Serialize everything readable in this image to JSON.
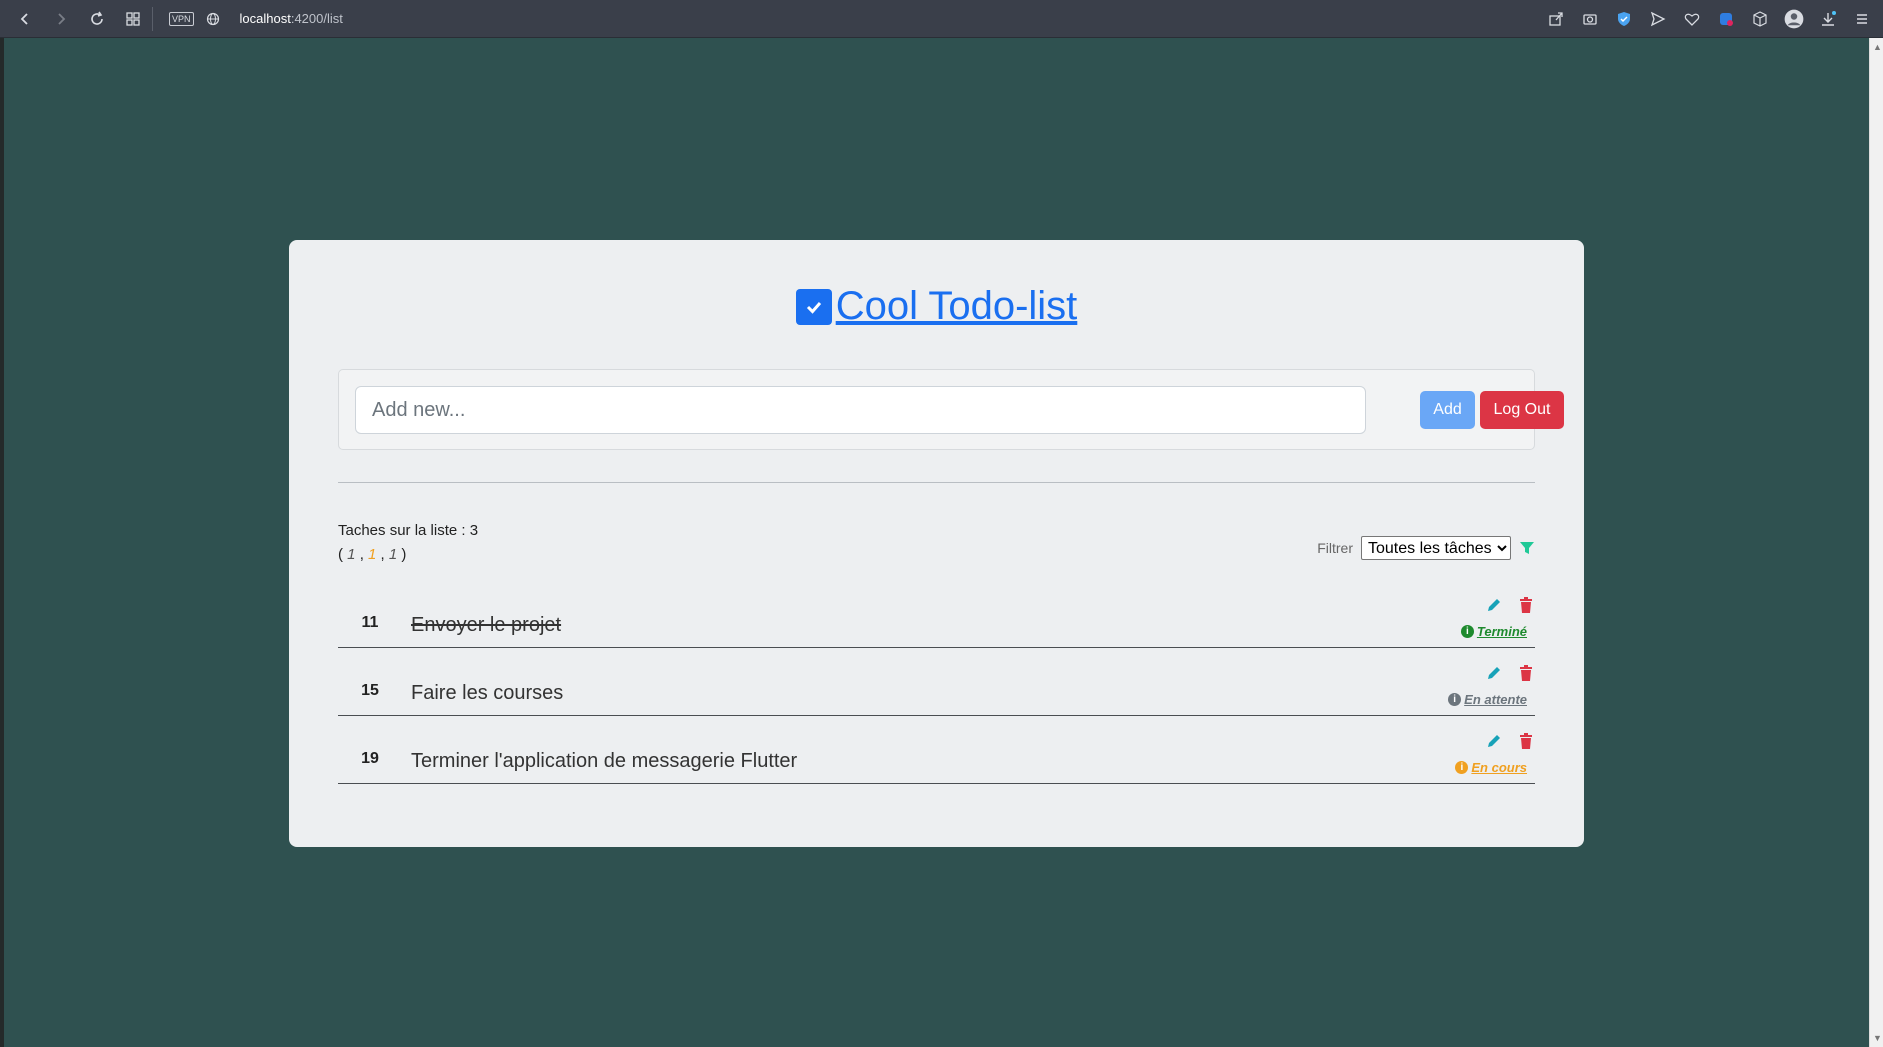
{
  "browser": {
    "url_host": "localhost",
    "url_path": ":4200/list",
    "vpn_label": "VPN"
  },
  "app": {
    "title": "Cool Todo-list",
    "add_placeholder": "Add new...",
    "add_label": "Add",
    "logout_label": "Log Out"
  },
  "summary": {
    "label": "Taches sur la liste : 3",
    "open": "(",
    "close": ")",
    "sep": ",",
    "counts": [
      "1",
      "1",
      "1"
    ]
  },
  "filter": {
    "label": "Filtrer",
    "selected": "Toutes les tâches",
    "icon": "filter-icon",
    "color": "#20c997"
  },
  "tasks": [
    {
      "id": "11",
      "text": "Envoyer le projet",
      "status": "Terminé",
      "status_color": "#1e8a2e",
      "done": true
    },
    {
      "id": "15",
      "text": "Faire les courses",
      "status": "En attente",
      "status_color": "#6c757d",
      "done": false
    },
    {
      "id": "19",
      "text": "Terminer l'application de messagerie Flutter",
      "status": "En cours",
      "status_color": "#f0a020",
      "done": false
    }
  ],
  "colors": {
    "accent": "#1a6ff0",
    "edit": "#17a2b8",
    "delete": "#dc3545",
    "background": "#2f5150"
  }
}
